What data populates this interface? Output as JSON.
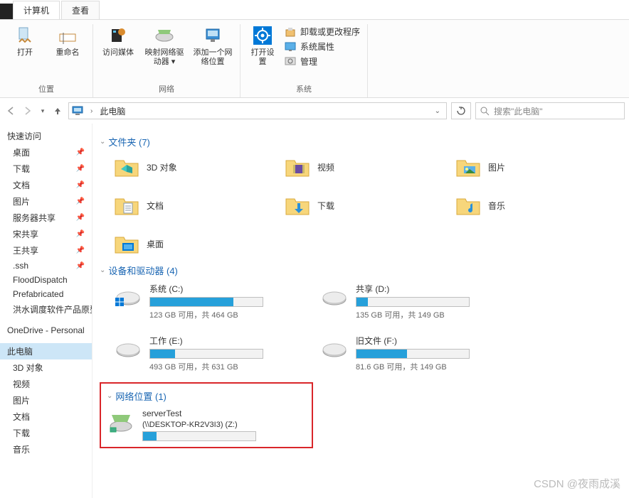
{
  "title_tabs": {
    "computer": "计算机",
    "view": "查看"
  },
  "ribbon": {
    "location": {
      "open": "打开",
      "rename": "重命名",
      "label": "位置"
    },
    "network": {
      "media": "访问媒体",
      "map": "映射网络驱动器 ▾",
      "addloc": "添加一个网络位置",
      "label": "网络"
    },
    "system": {
      "settings": "打开设置",
      "uninstall": "卸载或更改程序",
      "properties": "系统属性",
      "manage": "管理",
      "label": "系统"
    }
  },
  "addr": {
    "crumb": "此电脑",
    "search_placeholder": "搜索\"此电脑\""
  },
  "sidebar": {
    "quick": "快速访问",
    "items_pinned": [
      "桌面",
      "下载",
      "文档",
      "图片",
      "服务器共享",
      "宋共享",
      "王共享",
      ".ssh",
      "FloodDispatch",
      "Prefabricated",
      "洪水调度软件产品原型"
    ],
    "onedrive": "OneDrive - Personal",
    "thispc": "此电脑",
    "thispc_children": [
      "3D 对象",
      "视频",
      "图片",
      "文档",
      "下载",
      "音乐"
    ]
  },
  "content": {
    "folders_head": "文件夹 (7)",
    "folders": [
      {
        "name": "3D 对象",
        "icon": "3d"
      },
      {
        "name": "视频",
        "icon": "video"
      },
      {
        "name": "图片",
        "icon": "pic"
      },
      {
        "name": "文档",
        "icon": "doc"
      },
      {
        "name": "下载",
        "icon": "dl"
      },
      {
        "name": "音乐",
        "icon": "music"
      },
      {
        "name": "桌面",
        "icon": "desk"
      }
    ],
    "drives_head": "设备和驱动器 (4)",
    "drives": [
      {
        "name": "系统 (C:)",
        "stat": "123 GB 可用，共 464 GB",
        "fill": 74,
        "os": true
      },
      {
        "name": "共享 (D:)",
        "stat": "135 GB 可用，共 149 GB",
        "fill": 10
      },
      {
        "name": "工作 (E:)",
        "stat": "493 GB 可用，共 631 GB",
        "fill": 22
      },
      {
        "name": "旧文件 (F:)",
        "stat": "81.6 GB 可用，共 149 GB",
        "fill": 45
      }
    ],
    "net_head": "网络位置 (1)",
    "net": {
      "name": "serverTest",
      "path": "(\\\\DESKTOP-KR2V3I3) (Z:)",
      "fill": 12
    }
  },
  "watermark": "CSDN @夜雨成溪"
}
